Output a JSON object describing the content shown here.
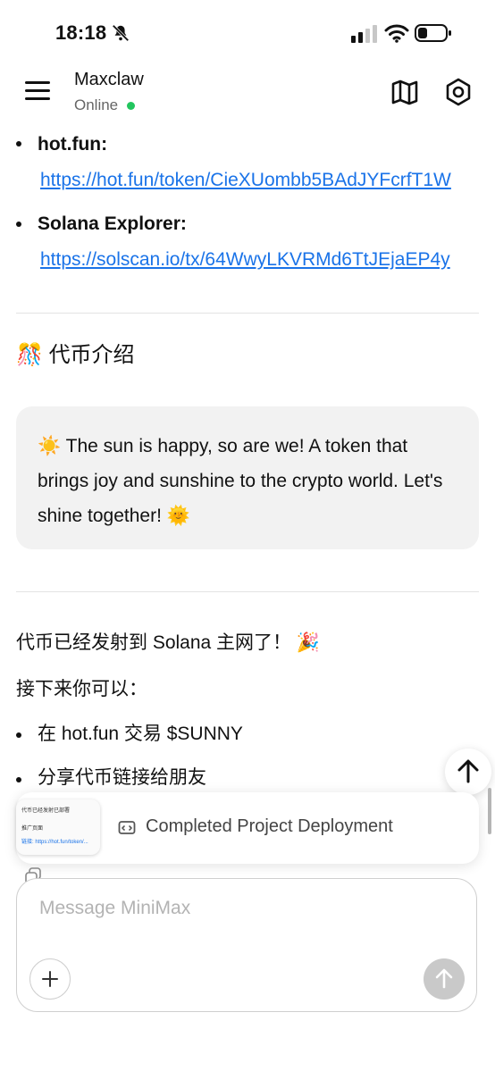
{
  "status_bar": {
    "time": "18:18"
  },
  "header": {
    "agent_name": "Maxclaw",
    "agent_status": "Online"
  },
  "links": [
    {
      "label": "hot.fun:",
      "url": "https://hot.fun/token/CieXUombb5BAdJYFcrfT1W"
    },
    {
      "label": "Solana Explorer:",
      "url": "https://solscan.io/tx/64WwyLKVRMd6TtJEjaEP4y"
    }
  ],
  "section": {
    "emoji": "🎊",
    "title": "代币介绍"
  },
  "quote": {
    "emoji_start": "☀️",
    "text": "The sun is happy, so are we! A token that brings joy and sunshine to the crypto world. Let's shine together!",
    "emoji_end": "🌞"
  },
  "announcement": {
    "text": "代币已经发射到 Solana 主网了！",
    "emoji": "🎉"
  },
  "next_steps": {
    "intro": "接下来你可以：",
    "items": [
      "在 hot.fun 交易 $SUNNY",
      "分享代币链接给朋友"
    ]
  },
  "deploy_card": {
    "label": "Completed Project Deployment",
    "thumb_line1": "代币已经发射已部署",
    "thumb_line2": "推广页面",
    "thumb_line3": "链接: https://hot.fun/token/..."
  },
  "composer": {
    "placeholder": "Message MiniMax"
  },
  "colors": {
    "link": "#1a73e8",
    "online": "#22c55e",
    "quote_bg": "#f2f2f2"
  }
}
